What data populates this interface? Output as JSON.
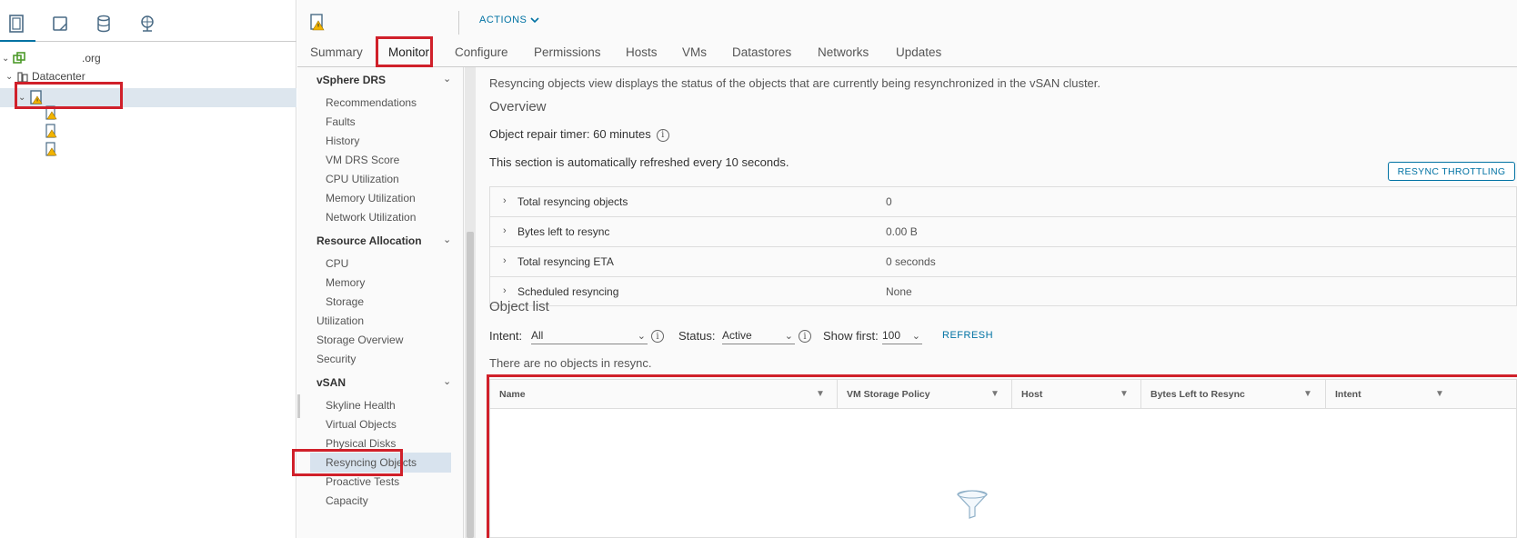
{
  "navigator": {
    "tabs": [
      "hosts-clusters-icon",
      "vms-templates-icon",
      "storage-icon",
      "networking-icon"
    ],
    "tree": {
      "root": ".org",
      "datacenter": "Datacenter"
    }
  },
  "header": {
    "actions_label": "ACTIONS"
  },
  "tabs": [
    {
      "label": "Summary"
    },
    {
      "label": "Monitor"
    },
    {
      "label": "Configure"
    },
    {
      "label": "Permissions"
    },
    {
      "label": "Hosts"
    },
    {
      "label": "VMs"
    },
    {
      "label": "Datastores"
    },
    {
      "label": "Networks"
    },
    {
      "label": "Updates"
    }
  ],
  "menu": {
    "drs_group": "vSphere DRS",
    "drs_items": [
      "Recommendations",
      "Faults",
      "History",
      "VM DRS Score",
      "CPU Utilization",
      "Memory Utilization",
      "Network Utilization"
    ],
    "resource_group": "Resource Allocation",
    "resource_items": [
      "CPU",
      "Memory",
      "Storage"
    ],
    "top_items": [
      "Utilization",
      "Storage Overview",
      "Security"
    ],
    "vsan_group": "vSAN",
    "vsan_items": [
      "Skyline Health",
      "Virtual Objects",
      "Physical Disks",
      "Resyncing Objects",
      "Proactive Tests",
      "Capacity"
    ]
  },
  "content": {
    "description": "Resyncing objects view displays the status of the objects that are currently being resynchronized in the vSAN cluster.",
    "overview_title": "Overview",
    "repair_timer": "Object repair timer: 60 minutes",
    "refresh_note": "This section is automatically refreshed every 10 seconds.",
    "throttle_button": "RESYNC THROTTLING",
    "stats": [
      {
        "label": "Total resyncing objects",
        "value": "0"
      },
      {
        "label": "Bytes left to resync",
        "value": "0.00 B"
      },
      {
        "label": "Total resyncing ETA",
        "value": "0 seconds"
      },
      {
        "label": "Scheduled resyncing",
        "value": "None"
      }
    ],
    "object_list_title": "Object list",
    "filters": {
      "intent_label": "Intent:",
      "intent_value": "All",
      "status_label": "Status:",
      "status_value": "Active",
      "show_first_label": "Show first:",
      "show_first_value": "100",
      "refresh": "REFRESH"
    },
    "empty_message": "There are no objects in resync.",
    "columns": [
      "Name",
      "VM Storage Policy",
      "Host",
      "Bytes Left to Resync",
      "Intent"
    ]
  },
  "colors": {
    "accent": "#0072a3",
    "highlight": "#d0202a",
    "selected": "#d8e3ee"
  }
}
